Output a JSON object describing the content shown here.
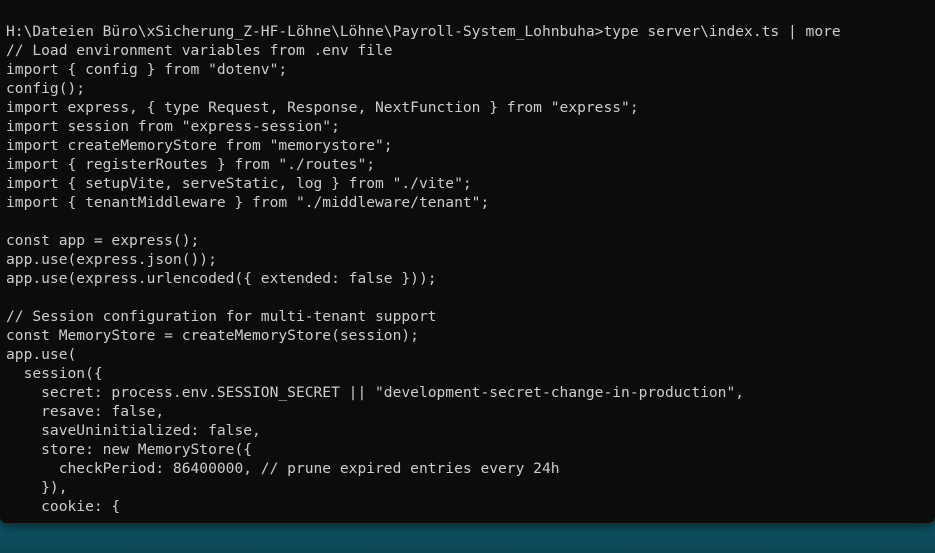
{
  "colors": {
    "terminal_background": "#0c0c0c",
    "terminal_text": "#cccccc",
    "desktop_accent": "#0d5a6c"
  },
  "terminal": {
    "prompt_line": "H:\\Dateien Büro\\xSicherung_Z-HF-Löhne\\Löhne\\Payroll-System_Lohnbuha>type server\\index.ts | more",
    "lines": [
      "// Load environment variables from .env file",
      "import { config } from \"dotenv\";",
      "config();",
      "import express, { type Request, Response, NextFunction } from \"express\";",
      "import session from \"express-session\";",
      "import createMemoryStore from \"memorystore\";",
      "import { registerRoutes } from \"./routes\";",
      "import { setupVite, serveStatic, log } from \"./vite\";",
      "import { tenantMiddleware } from \"./middleware/tenant\";",
      "",
      "const app = express();",
      "app.use(express.json());",
      "app.use(express.urlencoded({ extended: false }));",
      "",
      "// Session configuration for multi-tenant support",
      "const MemoryStore = createMemoryStore(session);",
      "app.use(",
      "  session({",
      "    secret: process.env.SESSION_SECRET || \"development-secret-change-in-production\",",
      "    resave: false,",
      "    saveUninitialized: false,",
      "    store: new MemoryStore({",
      "      checkPeriod: 86400000, // prune expired entries every 24h",
      "    }),",
      "    cookie: {"
    ]
  }
}
